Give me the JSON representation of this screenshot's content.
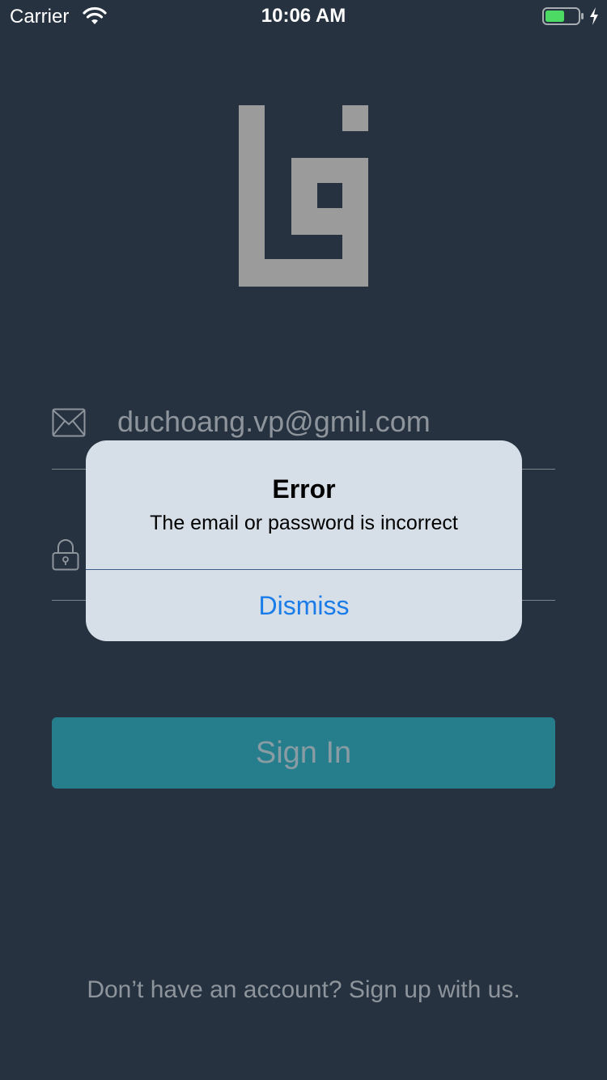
{
  "status_bar": {
    "carrier": "Carrier",
    "time": "10:06 AM",
    "battery_level": 0.6,
    "charging": true
  },
  "colors": {
    "background": "#263240",
    "accent_button": "#267e8c",
    "alert_background": "#d6dfe8",
    "alert_action": "#1a7ce8",
    "logo": "#9b9b9b",
    "battery_fill": "#4cd964"
  },
  "icons": {
    "wifi": "wifi-icon",
    "battery": "battery-icon",
    "charging": "charging-bolt-icon",
    "logo": "app-logo",
    "email": "mail-icon",
    "password": "lock-icon"
  },
  "form": {
    "email_value": "duchoang.vp@gmil.com",
    "password_value": ""
  },
  "sign_in_label": "Sign In",
  "signup_text": "Don’t have an account? Sign up with us.",
  "alert": {
    "title": "Error",
    "message": "The email or password is incorrect",
    "dismiss_label": "Dismiss"
  }
}
